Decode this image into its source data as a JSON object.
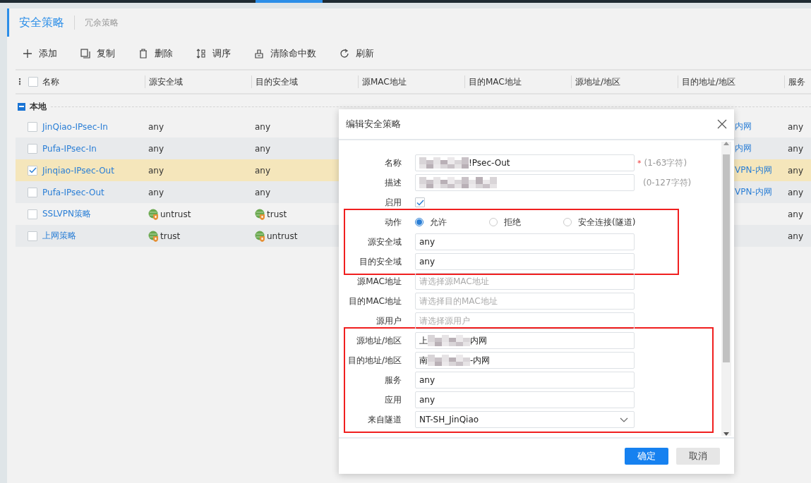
{
  "tabs": [
    {
      "label": "安全策略",
      "selected": true
    },
    {
      "label": "冗余策略",
      "selected": false
    }
  ],
  "toolbar": [
    {
      "kind": "add",
      "label": "添加"
    },
    {
      "kind": "copy",
      "label": "复制"
    },
    {
      "kind": "delete",
      "label": "删除"
    },
    {
      "kind": "reorder",
      "label": "调序"
    },
    {
      "kind": "clear",
      "label": "清除命中数"
    },
    {
      "kind": "refresh",
      "label": "刷新"
    }
  ],
  "table": {
    "columns": [
      "名称",
      "源安全域",
      "目的安全域",
      "源MAC地址",
      "目的MAC地址",
      "源地址/地区",
      "目的地址/地区",
      "服务"
    ],
    "menu_glyph": "⋮",
    "all_checked": false,
    "group": {
      "label": "本地",
      "expanded": true
    },
    "rows": [
      {
        "name": "JinQiao-IPsec-In",
        "checked": false,
        "selected": false,
        "src_zone": "any",
        "src_zone_icon": false,
        "dst_zone": "any",
        "dst_zone_icon": false,
        "dst_addr": "内网",
        "service": "any"
      },
      {
        "name": "Pufa-IPsec-In",
        "checked": false,
        "selected": false,
        "src_zone": "any",
        "src_zone_icon": false,
        "dst_zone": "any",
        "dst_zone_icon": false,
        "dst_addr": "内网",
        "service": "any"
      },
      {
        "name": "Jinqiao-IPsec-Out",
        "checked": true,
        "selected": true,
        "src_zone": "any",
        "src_zone_icon": false,
        "dst_zone": "any",
        "dst_zone_icon": false,
        "dst_addr": "VPN-内网",
        "service": "any"
      },
      {
        "name": "Pufa-IPsec-Out",
        "checked": false,
        "selected": false,
        "src_zone": "any",
        "src_zone_icon": false,
        "dst_zone": "any",
        "dst_zone_icon": false,
        "dst_addr": "VPN-内网",
        "service": "any"
      },
      {
        "name": "SSLVPN策略",
        "checked": false,
        "selected": false,
        "src_zone": "untrust",
        "src_zone_icon": true,
        "dst_zone": "trust",
        "dst_zone_icon": true,
        "service": "any"
      },
      {
        "name": "上网策略",
        "checked": false,
        "selected": false,
        "src_zone": "trust",
        "src_zone_icon": true,
        "dst_zone": "untrust",
        "dst_zone_icon": true,
        "service": "any"
      }
    ]
  },
  "dialog": {
    "title": "编辑安全策略",
    "sections": [
      {
        "framed": false,
        "rows": [
          {
            "kind": "text",
            "label": "名称",
            "value": "!Psec-Out",
            "pixelated": true,
            "required_mark": "*",
            "hint": "(1-63字符)"
          },
          {
            "kind": "text",
            "label": "描述",
            "pixelated": true,
            "hint": "(0-127字符)"
          },
          {
            "kind": "checkbox",
            "label": "启用",
            "checked": true
          }
        ]
      },
      {
        "framed": true,
        "rows": [
          {
            "kind": "radio",
            "label": "动作",
            "options": [
              {
                "label": "允许",
                "selected": true
              },
              {
                "label": "拒绝",
                "selected": false
              },
              {
                "label": "安全连接(隧道)",
                "selected": false
              }
            ]
          },
          {
            "kind": "text",
            "label": "源安全域",
            "value": "any",
            "pixelated": false
          },
          {
            "kind": "text",
            "label": "目的安全域",
            "value": "any",
            "pixelated": false
          }
        ]
      },
      {
        "framed": false,
        "rows": [
          {
            "kind": "text",
            "label": "源MAC地址",
            "placeholder": "请选择源MAC地址",
            "pixelated": false
          },
          {
            "kind": "text",
            "label": "目的MAC地址",
            "placeholder": "请选择目的MAC地址",
            "pixelated": false
          },
          {
            "kind": "text",
            "label": "源用户",
            "placeholder": "请选择源用户",
            "pixelated": false
          }
        ]
      },
      {
        "framed": true,
        "rows": [
          {
            "kind": "text",
            "label": "源地址/地区",
            "value_prefix": "上",
            "value": "内网",
            "pixelated": true
          },
          {
            "kind": "text",
            "label": "目的地址/地区",
            "value_prefix": "南",
            "value": "-内网",
            "pixelated": true
          },
          {
            "kind": "text",
            "label": "服务",
            "value": "any",
            "pixelated": false
          },
          {
            "kind": "text",
            "label": "应用",
            "value": "any",
            "pixelated": false
          },
          {
            "kind": "select",
            "label": "来自隧道",
            "value": "NT-SH_JinQiao"
          }
        ]
      }
    ],
    "buttons": [
      {
        "kind": "primary",
        "label": "确定"
      },
      {
        "kind": "secondary",
        "label": "取消"
      }
    ]
  }
}
